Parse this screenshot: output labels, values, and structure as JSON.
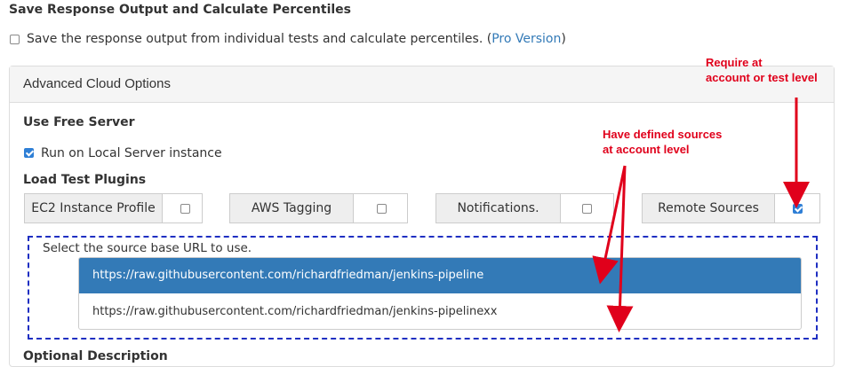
{
  "save_section": {
    "title": "Save Response Output and Calculate Percentiles",
    "checkbox_label": "Save the response output from individual tests and calculate percentiles. (",
    "pro_link": "Pro Version",
    "suffix": ")",
    "checked": false
  },
  "panel": {
    "title": "Advanced Cloud Options",
    "use_free_server": {
      "title": "Use Free Server",
      "checkbox_label": "Run on Local Server instance",
      "checked": true
    },
    "plugins": {
      "title": "Load Test Plugins",
      "items": [
        {
          "label": "EC2 Instance Profile",
          "checked": false
        },
        {
          "label": "AWS Tagging",
          "checked": false
        },
        {
          "label": "Notifications.",
          "checked": false
        },
        {
          "label": "Remote Sources",
          "checked": true
        }
      ]
    },
    "source": {
      "label": "Select the source base URL to use.",
      "options": [
        {
          "url": "https://raw.githubusercontent.com/richardfriedman/jenkins-pipeline",
          "selected": true
        },
        {
          "url": "https://raw.githubusercontent.com/richardfriedman/jenkins-pipelinexx",
          "selected": false
        }
      ]
    },
    "next_section_title": "Optional Description"
  },
  "annotations": {
    "require_line1": "Require at",
    "require_line2": "account or test level",
    "sources_line1": "Have defined sources",
    "sources_line2": "at account level"
  },
  "colors": {
    "annotation": "#e0001b",
    "selected_row": "#337ab7",
    "dashed_border": "#1f2fc2",
    "link": "#337ab7"
  }
}
